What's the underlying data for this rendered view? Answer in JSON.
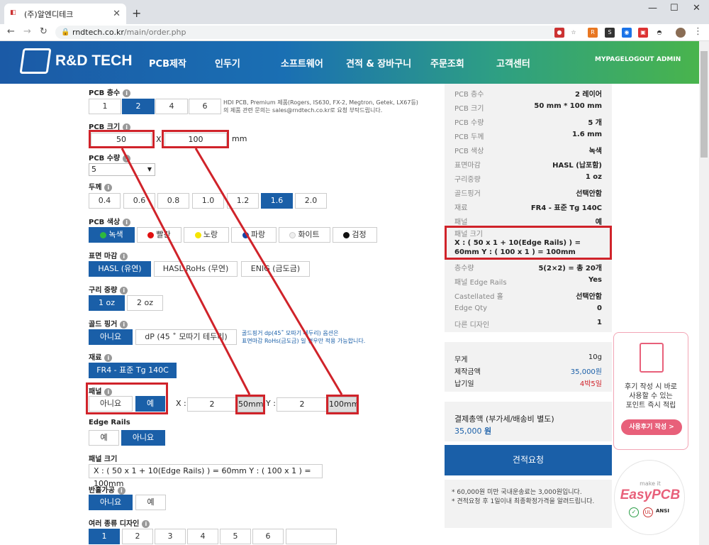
{
  "browser": {
    "tab_title": "(주)알엔디테크",
    "url_host": "rndtech.co.kr",
    "url_path": "/main/order.php"
  },
  "header": {
    "logo": "R&D TECH",
    "nav": [
      "PCB제작",
      "인두기",
      "소프트웨어",
      "견적 & 장바구니",
      "주문조회",
      "고객센터"
    ],
    "top_links": [
      "MYPAGE",
      "LOGOUT",
      "ADMIN"
    ]
  },
  "form": {
    "layers": {
      "label": "PCB 층수",
      "options": [
        "1",
        "2",
        "4",
        "6"
      ],
      "selected": "2",
      "note1": "HDI PCB, Premium 제품(Rogers, IS630, FX-2, Megtron, Getek, LX67등)",
      "note2": "의 제품 관련 문의는 sales@rndtech.co.kr로 요청 부탁드립니다."
    },
    "size": {
      "label": "PCB 크기",
      "width": "50",
      "x": "X",
      "height": "100",
      "unit": "mm"
    },
    "qty": {
      "label": "PCB 수량",
      "value": "5"
    },
    "thickness": {
      "label": "두께",
      "options": [
        "0.4",
        "0.6",
        "0.8",
        "1.0",
        "1.2",
        "1.6",
        "2.0"
      ],
      "selected": "1.6"
    },
    "color": {
      "label": "PCB 색상",
      "options": [
        "녹색",
        "빨간",
        "노랑",
        "파랑",
        "화이트",
        "검정"
      ],
      "selected": "녹색"
    },
    "finish": {
      "label": "표면 마감",
      "options": [
        "HASL (유연)",
        "HASL RoHs (무연)",
        "ENIG (금도금)"
      ],
      "selected": "HASL (유연)"
    },
    "copper": {
      "label": "구리 중량",
      "options": [
        "1 oz",
        "2 oz"
      ],
      "selected": "1 oz"
    },
    "goldfinger": {
      "label": "골드 핑거",
      "options": [
        "아니요",
        "dP (45 ˚ 모따기 테두리)"
      ],
      "selected": "아니요",
      "note1": "골드핑거 dp(45˚ 모따기 테두리) 옵션은",
      "note2": "표면마감 RoHs(금도금) 일 경우만 적용 가능합니다."
    },
    "material": {
      "label": "재료",
      "value": "FR4 - 표준 Tg 140C"
    },
    "panel": {
      "label": "패널",
      "options": [
        "아니요",
        "예"
      ],
      "selected": "예",
      "x_label": "X :",
      "x_value": "2",
      "x_unit": "50mm",
      "y_label": "Y :",
      "y_value": "2",
      "y_unit": "100mm"
    },
    "edge_rails": {
      "label": "Edge Rails",
      "options": [
        "예",
        "아니요"
      ],
      "selected": "아니요"
    },
    "panel_size": {
      "label": "패널 크기",
      "value": "X : ( 50 x 1 + 10(Edge Rails) ) = 60mm   Y : ( 100 x 1 ) = 100mm"
    },
    "halfhole": {
      "label": "반홀가공",
      "options": [
        "아니요",
        "예"
      ],
      "selected": "아니요"
    },
    "designs": {
      "label": "여러 종류 디자인",
      "options": [
        "1",
        "2",
        "3",
        "4",
        "5",
        "6"
      ],
      "selected": "1"
    }
  },
  "summary": {
    "rows": [
      {
        "k": "PCB 층수",
        "v": "2 레이어"
      },
      {
        "k": "PCB 크기",
        "v": "50 mm * 100 mm"
      },
      {
        "k": "PCB 수량",
        "v": "5 개"
      },
      {
        "k": "PCB 두께",
        "v": "1.6 mm"
      },
      {
        "k": "PCB 색상",
        "v": "녹색"
      },
      {
        "k": "표면마감",
        "v": "HASL (납포함)"
      },
      {
        "k": "구리중량",
        "v": "1 oz"
      },
      {
        "k": "골드핑거",
        "v": "선택안함"
      },
      {
        "k": "재료",
        "v": "FR4 - 표준 Tg 140C"
      },
      {
        "k": "패널",
        "v": "예"
      }
    ],
    "panel_size_label": "패널 크기",
    "panel_size_value": "X : ( 50 x 1 + 10(Edge Rails) ) = 60mm   Y : ( 100 x 1 ) = 100mm",
    "rows2": [
      {
        "k": "층수량",
        "v": "5(2×2) = 총 20개"
      },
      {
        "k": "패널 Edge Rails",
        "v": "Yes"
      },
      {
        "k": "Castellated 홀",
        "v": "선택안함"
      },
      {
        "k": "Edge Qty",
        "v": "0"
      },
      {
        "k": "다른 디자인",
        "v": "1"
      }
    ]
  },
  "cost": {
    "weight_label": "무게",
    "weight": "10g",
    "price_label": "제작금액",
    "price": "35,000원",
    "lead_label": "납기일",
    "lead": "4박5일"
  },
  "pay": {
    "label": "결제총액 (부가세/배송비 별도)",
    "amount": "35,000",
    "unit": "원"
  },
  "quote_button": "견적요청",
  "notes": [
    "* 60,000원 미만 국내운송료는 3,000원입니다.",
    "* 견적요청 후 1일이내 최종확정가격을 알려드립니다."
  ],
  "review": {
    "line1": "후기 작성 시 바로",
    "line2": "사용할 수 있는",
    "line3": "포인트 즉시 적립",
    "button": "사용후기 작성 >"
  },
  "easypcb": {
    "top": "make it",
    "brand": "EasyPCB",
    "badge": "ANSI"
  }
}
